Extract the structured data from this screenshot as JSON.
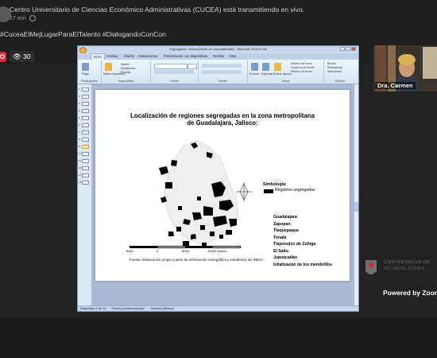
{
  "post": {
    "title": "Centro Universitario de Ciencias Económico Administrativas (CUCEA) está transmitiendo en vivo.",
    "time": "17 min",
    "hashtags": "#CuceaElMejLugarParaElTalento #DialogandoConCon"
  },
  "live": {
    "badge": "O",
    "viewers": "30"
  },
  "powerpoint": {
    "window_title": "Segregación urbana [Modo de compatibilidad] - Microsoft PowerPoint",
    "tabs": [
      "Inicio",
      "Insertar",
      "Diseño",
      "Animaciones",
      "Presentación con diapositivas",
      "Revisar",
      "Vista"
    ],
    "ribbon_groups": [
      "Portapapeles",
      "Diapositivas",
      "Fuente",
      "Párrafo",
      "Dibujo",
      "Edición"
    ],
    "ribbon_items": {
      "paste": "Pegar",
      "new_slide": "Nueva diapositiva",
      "layout": "Diseño",
      "reset": "Restablecer",
      "delete": "Eliminar",
      "shapes": "Formas",
      "arrange": "Organizar",
      "quick_styles": "Estilos rápidos",
      "find": "Buscar",
      "replace": "Reemplazar",
      "select": "Seleccionar",
      "fill": "Relleno de forma",
      "outline": "Contorno de forma",
      "effects": "Efectos de forma"
    },
    "slide_count": 14,
    "active_slide": 9,
    "status": {
      "slide": "Diapositiva 9 de 14",
      "theme": "\"Diseño predeterminado\"",
      "language": "Español (México)"
    }
  },
  "slide": {
    "title_line1": "Localización de regiones segregadas en la zona metropolitana",
    "title_line2": "de Guadalajara, Jalisco:",
    "simbologia": "Simbología:",
    "legend_label": "Regiones segregadas",
    "municipios": [
      "Guadalajara",
      "Zapopan",
      "Tlaquepaque",
      "Tonalá",
      "Tlajomulco de Zúñiga",
      "El Salto",
      "Juanacatlán",
      "Ixtlahuacán de los membrillos"
    ],
    "scale_labels": [
      "5000",
      "0",
      "5000",
      "10000 Metros"
    ],
    "source": "Fuente: Elaboración propia a partir de información cartográfica y estadística del INEGI."
  },
  "participant": {
    "name": "Dra. Carmen"
  },
  "brand": {
    "line1": "UNIVERSIDAD DE",
    "line2": "GUADALAJARA"
  },
  "footer": {
    "powered_by": "Powered by Zoom"
  },
  "colors": {
    "live_red": "#e4283c",
    "ppt_blue": "#c6d6ec"
  }
}
